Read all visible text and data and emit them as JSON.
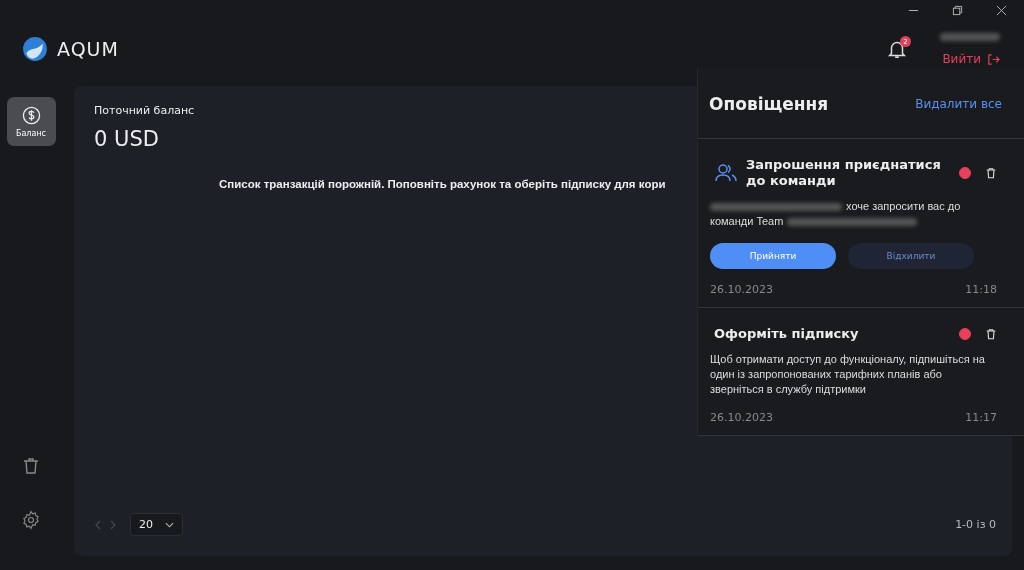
{
  "app": {
    "name": "AQUM"
  },
  "header": {
    "notification_count": "2",
    "logout": "Вийти"
  },
  "sidebar": {
    "items": [
      {
        "label": "Баланс",
        "kind": "balance",
        "selected": true
      }
    ],
    "bottom": [
      {
        "kind": "trash"
      },
      {
        "kind": "settings"
      }
    ]
  },
  "balance": {
    "label": "Поточний баланс",
    "value": "0 USD"
  },
  "empty_message": "Список транзакцій порожній. Поповніть рахунок та оберіть підписку для кори",
  "pagination": {
    "page_size": "20",
    "range": "1-0 із 0"
  },
  "notifications": {
    "title": "Оповіщення",
    "clear_all": "Видалити все",
    "items": [
      {
        "kind": "invite",
        "title": "Запрошення приєднатися до команди",
        "text_before": "хоче запросити вас до",
        "text_team": "команди Team",
        "unread": true,
        "accept": "Прийняти",
        "decline": "Відхилити",
        "date": "26.10.2023",
        "time": "11:18"
      },
      {
        "kind": "info",
        "title": "Оформіть підписку",
        "text": "Щоб отримати доступ до функціоналу, підпишіться на один із запропонованих тарифних планів або зверніться в службу підтримки",
        "unread": true,
        "date": "26.10.2023",
        "time": "11:17"
      }
    ]
  }
}
